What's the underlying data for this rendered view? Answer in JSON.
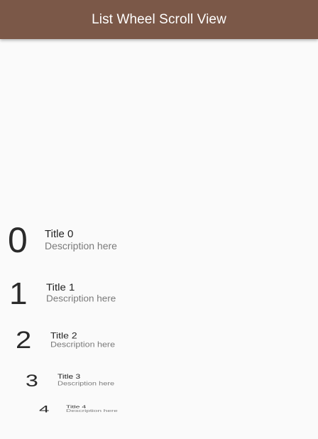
{
  "appbar": {
    "title": "List Wheel Scroll View",
    "color": "#7b5848"
  },
  "wheel": {
    "items": [
      {
        "leading": "0",
        "title": "Title 0",
        "description": "Description here"
      },
      {
        "leading": "1",
        "title": "Title 1",
        "description": "Description here"
      },
      {
        "leading": "2",
        "title": "Title 2",
        "description": "Description here"
      },
      {
        "leading": "3",
        "title": "Title 3",
        "description": "Description here"
      },
      {
        "leading": "4",
        "title": "Title 4",
        "description": "Description here"
      }
    ]
  }
}
